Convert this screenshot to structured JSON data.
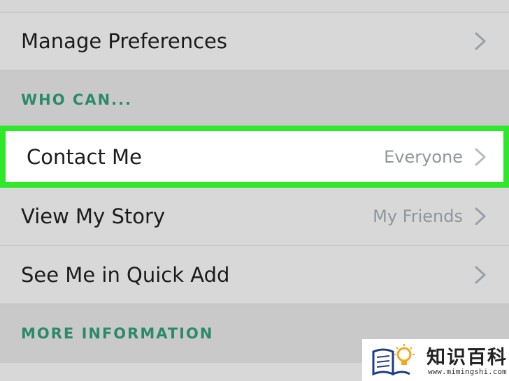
{
  "rows": {
    "manage_preferences": {
      "label": "Manage Preferences"
    },
    "contact_me": {
      "label": "Contact Me",
      "value": "Everyone"
    },
    "view_my_story": {
      "label": "View My Story",
      "value": "My Friends"
    },
    "quick_add": {
      "label": "See Me in Quick Add"
    }
  },
  "sections": {
    "who_can": "WHO CAN...",
    "more_information": "MORE INFORMATION"
  },
  "watermark": {
    "title": "知识百科",
    "url": "www.mimingshi.com"
  },
  "colors": {
    "highlight_border": "#2ee829",
    "section_text": "#2a8a6b",
    "value_text": "#8f959b"
  }
}
